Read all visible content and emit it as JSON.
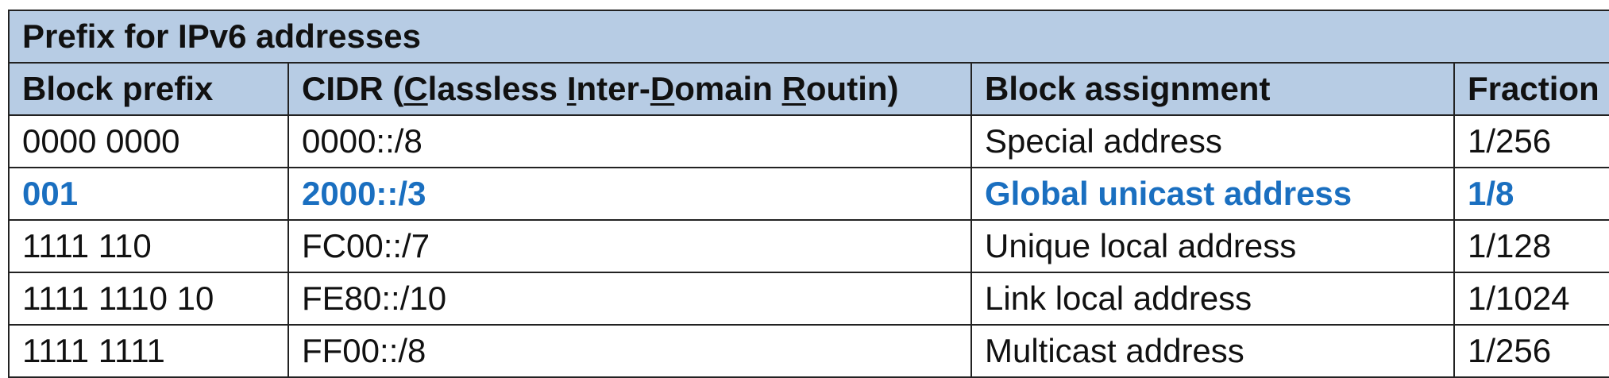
{
  "title": "Prefix for IPv6 addresses",
  "columns": {
    "block_prefix": "Block prefix",
    "cidr": {
      "prefix": "CIDR (",
      "c_letter": "C",
      "c_rest": "lassless ",
      "i_letter": "I",
      "i_rest": "nter-",
      "d_letter": "D",
      "d_rest": "omain ",
      "r_letter": "R",
      "r_rest": "outin)"
    },
    "block_assignment": "Block assignment",
    "fraction": "Fraction"
  },
  "rows": [
    {
      "block_prefix": "0000 0000",
      "cidr": "0000::/8",
      "block_assignment": "Special address",
      "fraction": "1/256",
      "highlighted": false
    },
    {
      "block_prefix": "001",
      "cidr": "2000::/3",
      "block_assignment": "Global unicast address",
      "fraction": "1/8",
      "highlighted": true
    },
    {
      "block_prefix": "1111 110",
      "cidr": "FC00::/7",
      "block_assignment": "Unique local address",
      "fraction": "1/128",
      "highlighted": false
    },
    {
      "block_prefix": "1111 1110 10",
      "cidr": "FE80::/10",
      "block_assignment": "Link local address",
      "fraction": "1/1024",
      "highlighted": false
    },
    {
      "block_prefix": "1111 1111",
      "cidr": "FF00::/8",
      "block_assignment": "Multicast address",
      "fraction": "1/256",
      "highlighted": false
    }
  ],
  "colors": {
    "header_background": "#b7cce4",
    "highlight_text": "#1a6fc0",
    "border": "#222222"
  }
}
